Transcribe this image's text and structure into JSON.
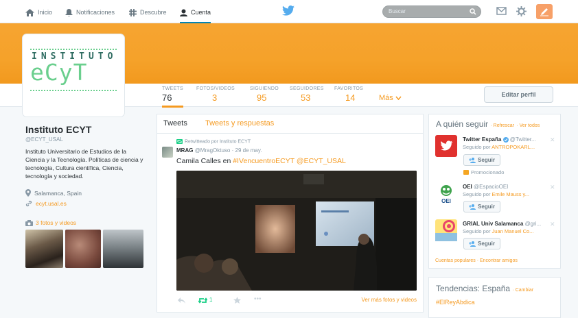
{
  "nav": {
    "items": [
      {
        "label": "Inicio",
        "icon": "home-icon"
      },
      {
        "label": "Notificaciones",
        "icon": "bell-icon"
      },
      {
        "label": "Descubre",
        "icon": "hashtag-icon"
      },
      {
        "label": "Cuenta",
        "icon": "user-icon"
      }
    ],
    "search_placeholder": "Buscar"
  },
  "profile": {
    "avatar_text_top": "INSTITUTO",
    "avatar_text_bottom": "eCyT",
    "name": "Instituto ECYT",
    "handle": "@ECYT_USAL",
    "bio": "Instituto Universitario de Estudios de la Ciencia y la Tecnología. Políticas de ciencia y tecnología, Cultura científica, Ciencia, tecnología y sociedad.",
    "location": "Salamanca, Spain",
    "url": "ecyt.usal.es",
    "photos_link": "3 fotos y videos"
  },
  "stats": [
    {
      "label": "TWEETS",
      "value": "76"
    },
    {
      "label": "FOTOS/VIDEOS",
      "value": "3"
    },
    {
      "label": "SIGUIENDO",
      "value": "95"
    },
    {
      "label": "SEGUIDORES",
      "value": "53"
    },
    {
      "label": "FAVORITOS",
      "value": "14"
    }
  ],
  "more_label": "Más",
  "edit_profile_label": "Editar perfil",
  "timeline": {
    "tab_tweets": "Tweets",
    "tab_replies": "Tweets y respuestas",
    "retweet_note": "Retwitteado por Instituto ECYT",
    "author_name": "MRAG",
    "author_handle": "@MragOktuso",
    "date": "· 29 de may.",
    "text_plain": "Camila Calles en ",
    "hashtag": "#IVencuentroECYT",
    "mention": "@ECYT_USAL",
    "retweet_count": "1",
    "more_photos": "Ver más fotos y videos"
  },
  "who_to_follow": {
    "title": "A quién seguir",
    "refresh": "· Refrescar",
    "view_all": "· Ver todos",
    "follow_label": "Seguir",
    "promoted_label": "Promocionado",
    "suggestions": [
      {
        "name": "Twitter España",
        "handle": "@Twitter...",
        "followed_by_prefix": "Seguido por ",
        "followed_by": "ANTROPOKARL..."
      },
      {
        "name": "OEI",
        "handle": "@EspacioOEI",
        "followed_by_prefix": "Seguido por ",
        "followed_by": "Emile Mauss y..."
      },
      {
        "name": "GRIAL Univ Salamanca",
        "handle": "@gri...",
        "followed_by_prefix": "Seguido por ",
        "followed_by": "Juan Manuel Co..."
      }
    ],
    "footer": "Cuentas populares · Encontrar amigos"
  },
  "trends": {
    "title": "Tendencias: España",
    "change": "· Cambiar",
    "first": "#ElReyAbdica"
  },
  "colors": {
    "accent": "#f59a20",
    "banner": "#f6a431",
    "link_blue": "#0084b4"
  }
}
